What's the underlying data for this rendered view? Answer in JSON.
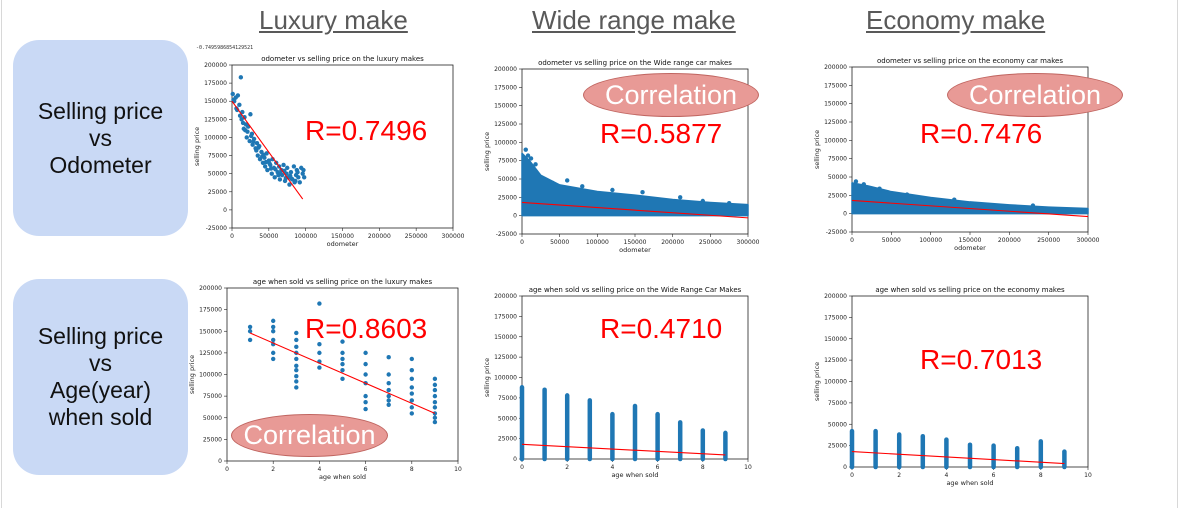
{
  "header": {
    "luxury": "Luxury make",
    "wide": "Wide range make",
    "economy": "Economy make"
  },
  "rows": {
    "odometer": {
      "line1": "Selling price",
      "line2": "vs",
      "line3": "Odometer"
    },
    "age": {
      "line1": "Selling price",
      "line2": "vs",
      "line3": "Age(year)",
      "line4": "when sold"
    }
  },
  "r_values": {
    "lux_odo": "R=0.7496",
    "wide_odo": "R=0.5877",
    "eco_odo": "R=0.7476",
    "lux_age": "R=0.8603",
    "wide_age": "R=0.4710",
    "eco_age": "R=0.7013"
  },
  "correlation_label": "Correlation",
  "printed_stat": "-0.7495986854129521",
  "colors": {
    "points": "#1f77b4",
    "fit_line": "#ff0000",
    "row_box": "#c9d9f5",
    "badge": "#e89a96",
    "r_text": "#ff0000"
  },
  "chart_data": [
    {
      "id": "lux_odo",
      "type": "scatter",
      "title": "odometer vs selling price on the luxury makes",
      "xlabel": "odometer",
      "ylabel": "selling price",
      "xlim": [
        0,
        300000
      ],
      "ylim": [
        -25000,
        200000
      ],
      "xticks": [
        0,
        50000,
        100000,
        150000,
        200000,
        250000,
        300000
      ],
      "yticks": [
        -25000,
        0,
        25000,
        50000,
        75000,
        100000,
        125000,
        150000,
        175000,
        200000
      ],
      "points": [
        [
          1000,
          160000
        ],
        [
          3000,
          150000
        ],
        [
          5000,
          155000
        ],
        [
          6000,
          140000
        ],
        [
          8000,
          158000
        ],
        [
          10000,
          145000
        ],
        [
          12000,
          183000
        ],
        [
          14000,
          135000
        ],
        [
          15000,
          120000
        ],
        [
          17000,
          128000
        ],
        [
          18000,
          110000
        ],
        [
          20000,
          100000
        ],
        [
          22000,
          115000
        ],
        [
          24000,
          95000
        ],
        [
          25000,
          132000
        ],
        [
          27000,
          105000
        ],
        [
          28000,
          90000
        ],
        [
          30000,
          98000
        ],
        [
          32000,
          85000
        ],
        [
          34000,
          92000
        ],
        [
          35000,
          75000
        ],
        [
          37000,
          88000
        ],
        [
          38000,
          70000
        ],
        [
          40000,
          80000
        ],
        [
          42000,
          65000
        ],
        [
          44000,
          72000
        ],
        [
          45000,
          60000
        ],
        [
          47000,
          78000
        ],
        [
          48000,
          55000
        ],
        [
          50000,
          68000
        ],
        [
          52000,
          62000
        ],
        [
          54000,
          50000
        ],
        [
          55000,
          70000
        ],
        [
          57000,
          58000
        ],
        [
          58000,
          45000
        ],
        [
          60000,
          65000
        ],
        [
          62000,
          52000
        ],
        [
          64000,
          60000
        ],
        [
          65000,
          42000
        ],
        [
          67000,
          55000
        ],
        [
          68000,
          48000
        ],
        [
          70000,
          62000
        ],
        [
          72000,
          40000
        ],
        [
          74000,
          50000
        ],
        [
          75000,
          58000
        ],
        [
          77000,
          45000
        ],
        [
          78000,
          35000
        ],
        [
          80000,
          52000
        ],
        [
          82000,
          42000
        ],
        [
          84000,
          60000
        ],
        [
          85000,
          38000
        ],
        [
          87000,
          48000
        ],
        [
          88000,
          55000
        ],
        [
          90000,
          45000
        ],
        [
          92000,
          38000
        ],
        [
          94000,
          58000
        ],
        [
          96000,
          50000
        ],
        [
          98000,
          45000
        ],
        [
          13000,
          125000
        ],
        [
          16000,
          112000
        ],
        [
          19000,
          118000
        ],
        [
          26000,
          102000
        ],
        [
          33000,
          82000
        ],
        [
          41000,
          74000
        ],
        [
          46000,
          66000
        ],
        [
          53000,
          57000
        ],
        [
          63000,
          48000
        ],
        [
          71000,
          54000
        ],
        [
          79000,
          47000
        ],
        [
          86000,
          40000
        ],
        [
          2000,
          152000
        ],
        [
          7000,
          138000
        ],
        [
          11000,
          130000
        ],
        [
          21000,
          108000
        ],
        [
          29000,
          94000
        ],
        [
          36000,
          86000
        ],
        [
          43000,
          76000
        ],
        [
          51000,
          64000
        ],
        [
          59000,
          56000
        ],
        [
          66000,
          50000
        ],
        [
          73000,
          44000
        ],
        [
          81000,
          43000
        ],
        [
          89000,
          52000
        ],
        [
          97000,
          55000
        ]
      ],
      "fit": [
        [
          0,
          150000
        ],
        [
          96000,
          15000
        ]
      ]
    },
    {
      "id": "wide_odo",
      "type": "scatter",
      "title": "odometer vs selling price on the Wide range car makes",
      "xlabel": "odometer",
      "ylabel": "selling price",
      "xlim": [
        0,
        300000
      ],
      "ylim": [
        -25000,
        200000
      ],
      "xticks": [
        0,
        50000,
        100000,
        150000,
        200000,
        250000,
        300000
      ],
      "yticks": [
        -25000,
        0,
        25000,
        50000,
        75000,
        100000,
        125000,
        150000,
        175000,
        200000
      ],
      "band_top": [
        [
          0,
          85000
        ],
        [
          10000,
          75000
        ],
        [
          25000,
          55000
        ],
        [
          50000,
          42000
        ],
        [
          100000,
          33000
        ],
        [
          150000,
          28000
        ],
        [
          200000,
          22000
        ],
        [
          250000,
          18000
        ],
        [
          300000,
          15000
        ]
      ],
      "band_bottom": [
        [
          0,
          0
        ],
        [
          300000,
          0
        ]
      ],
      "outliers": [
        [
          5000,
          90000
        ],
        [
          8000,
          82000
        ],
        [
          12000,
          78000
        ],
        [
          18000,
          70000
        ],
        [
          40000,
          45000
        ],
        [
          60000,
          48000
        ],
        [
          80000,
          40000
        ],
        [
          120000,
          35000
        ],
        [
          160000,
          32000
        ],
        [
          210000,
          25000
        ],
        [
          240000,
          20000
        ],
        [
          275000,
          17000
        ]
      ],
      "fit": [
        [
          0,
          18000
        ],
        [
          300000,
          -3000
        ]
      ]
    },
    {
      "id": "eco_odo",
      "type": "scatter",
      "title": "odometer vs selling price on the economy car makes",
      "xlabel": "odometer",
      "ylabel": "selling price",
      "xlim": [
        0,
        300000
      ],
      "ylim": [
        -25000,
        200000
      ],
      "xticks": [
        0,
        50000,
        100000,
        150000,
        200000,
        250000,
        300000
      ],
      "yticks": [
        -25000,
        0,
        25000,
        50000,
        75000,
        100000,
        125000,
        150000,
        175000,
        200000
      ],
      "band_top": [
        [
          0,
          42000
        ],
        [
          20000,
          38000
        ],
        [
          50000,
          30000
        ],
        [
          100000,
          22000
        ],
        [
          150000,
          16000
        ],
        [
          200000,
          12000
        ],
        [
          250000,
          9000
        ],
        [
          300000,
          7000
        ]
      ],
      "band_bottom": [
        [
          0,
          0
        ],
        [
          300000,
          0
        ]
      ],
      "outliers": [
        [
          5000,
          44000
        ],
        [
          15000,
          40000
        ],
        [
          35000,
          34000
        ],
        [
          70000,
          26000
        ],
        [
          130000,
          19000
        ],
        [
          230000,
          11000
        ]
      ],
      "fit": [
        [
          0,
          18000
        ],
        [
          300000,
          -4000
        ]
      ]
    },
    {
      "id": "lux_age",
      "type": "scatter",
      "title": "age when sold vs selling price on the luxury makes",
      "xlabel": "age when sold",
      "ylabel": "selling price",
      "xlim": [
        0,
        10
      ],
      "ylim": [
        0,
        200000
      ],
      "xticks": [
        0,
        2,
        4,
        6,
        8,
        10
      ],
      "yticks": [
        0,
        25000,
        50000,
        75000,
        100000,
        125000,
        150000,
        175000,
        200000
      ],
      "points": [
        [
          1,
          155000
        ],
        [
          1,
          150000
        ],
        [
          1,
          140000
        ],
        [
          2,
          162000
        ],
        [
          2,
          155000
        ],
        [
          2,
          150000
        ],
        [
          2,
          140000
        ],
        [
          2,
          135000
        ],
        [
          2,
          125000
        ],
        [
          2,
          118000
        ],
        [
          3,
          148000
        ],
        [
          3,
          140000
        ],
        [
          3,
          132000
        ],
        [
          3,
          125000
        ],
        [
          3,
          118000
        ],
        [
          3,
          110000
        ],
        [
          3,
          105000
        ],
        [
          3,
          98000
        ],
        [
          3,
          92000
        ],
        [
          3,
          85000
        ],
        [
          4,
          182000
        ],
        [
          4,
          135000
        ],
        [
          4,
          125000
        ],
        [
          4,
          115000
        ],
        [
          4,
          108000
        ],
        [
          5,
          138000
        ],
        [
          5,
          125000
        ],
        [
          5,
          118000
        ],
        [
          5,
          112000
        ],
        [
          5,
          105000
        ],
        [
          5,
          95000
        ],
        [
          6,
          125000
        ],
        [
          6,
          112000
        ],
        [
          6,
          100000
        ],
        [
          6,
          90000
        ],
        [
          6,
          75000
        ],
        [
          6,
          68000
        ],
        [
          6,
          60000
        ],
        [
          7,
          120000
        ],
        [
          7,
          100000
        ],
        [
          7,
          90000
        ],
        [
          7,
          82000
        ],
        [
          7,
          75000
        ],
        [
          7,
          70000
        ],
        [
          7,
          65000
        ],
        [
          8,
          118000
        ],
        [
          8,
          105000
        ],
        [
          8,
          95000
        ],
        [
          8,
          85000
        ],
        [
          8,
          78000
        ],
        [
          8,
          70000
        ],
        [
          8,
          62000
        ],
        [
          8,
          55000
        ],
        [
          9,
          95000
        ],
        [
          9,
          88000
        ],
        [
          9,
          82000
        ],
        [
          9,
          75000
        ],
        [
          9,
          68000
        ],
        [
          9,
          62000
        ],
        [
          9,
          55000
        ],
        [
          9,
          50000
        ],
        [
          9,
          45000
        ]
      ],
      "fit": [
        [
          1,
          148000
        ],
        [
          9,
          55000
        ]
      ]
    },
    {
      "id": "wide_age",
      "type": "scatter",
      "title": "age when sold vs selling price on the Wide Range Car Makes",
      "xlabel": "age when sold",
      "ylabel": "selling price",
      "xlim": [
        0,
        10
      ],
      "ylim": [
        0,
        200000
      ],
      "xticks": [
        0,
        2,
        4,
        6,
        8,
        10
      ],
      "yticks": [
        0,
        25000,
        50000,
        75000,
        100000,
        125000,
        150000,
        175000,
        200000
      ],
      "columns": [
        [
          0,
          88000
        ],
        [
          1,
          85000
        ],
        [
          2,
          78000
        ],
        [
          3,
          72000
        ],
        [
          4,
          55000
        ],
        [
          5,
          65000
        ],
        [
          6,
          55000
        ],
        [
          7,
          45000
        ],
        [
          8,
          35000
        ],
        [
          9,
          32000
        ]
      ],
      "fit": [
        [
          0,
          18000
        ],
        [
          9,
          5000
        ]
      ]
    },
    {
      "id": "eco_age",
      "type": "scatter",
      "title": "age when sold vs selling price on the economy makes",
      "xlabel": "age when sold",
      "ylabel": "selling price",
      "xlim": [
        0,
        10
      ],
      "ylim": [
        0,
        200000
      ],
      "xticks": [
        0,
        2,
        4,
        6,
        8,
        10
      ],
      "yticks": [
        0,
        25000,
        50000,
        75000,
        100000,
        125000,
        150000,
        175000,
        200000
      ],
      "columns": [
        [
          0,
          42000
        ],
        [
          1,
          42000
        ],
        [
          2,
          38000
        ],
        [
          3,
          36000
        ],
        [
          4,
          32000
        ],
        [
          5,
          26000
        ],
        [
          6,
          25000
        ],
        [
          7,
          22000
        ],
        [
          8,
          30000
        ],
        [
          9,
          18000
        ]
      ],
      "fit": [
        [
          0,
          18000
        ],
        [
          9,
          4000
        ]
      ]
    }
  ]
}
